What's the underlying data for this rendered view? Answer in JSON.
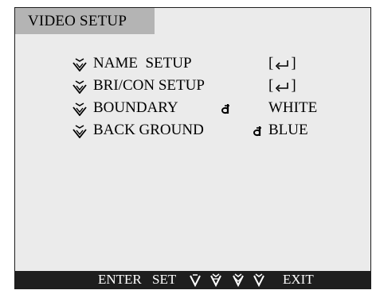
{
  "title": "VIDEO SETUP",
  "menu": {
    "items": [
      {
        "label": "NAME  SETUP",
        "value": "[",
        "value_end": "]",
        "icon": "enter-key-icon"
      },
      {
        "label": "BRI/CON SETUP",
        "value": "[",
        "value_end": "]",
        "icon": "enter-key-icon"
      },
      {
        "label": "BOUNDARY",
        "value": "WHITE",
        "icon": "adjust-icon"
      },
      {
        "label": "BACK GROUND",
        "value": "BLUE",
        "icon": "adjust-icon"
      }
    ],
    "bullet_icon": "selection-bullet-icon"
  },
  "footer": {
    "enter_label": "ENTER",
    "set_label": "SET",
    "exit_label": "EXIT",
    "nav_icons": [
      "up-key-icon",
      "down-key-icon",
      "left-key-icon",
      "right-key-icon"
    ]
  },
  "colors": {
    "screen_background": "#ebebeb",
    "title_background": "#b4b4b4",
    "footer_background": "#1e1e1e",
    "footer_text": "#ffffff",
    "text": "#000000"
  }
}
